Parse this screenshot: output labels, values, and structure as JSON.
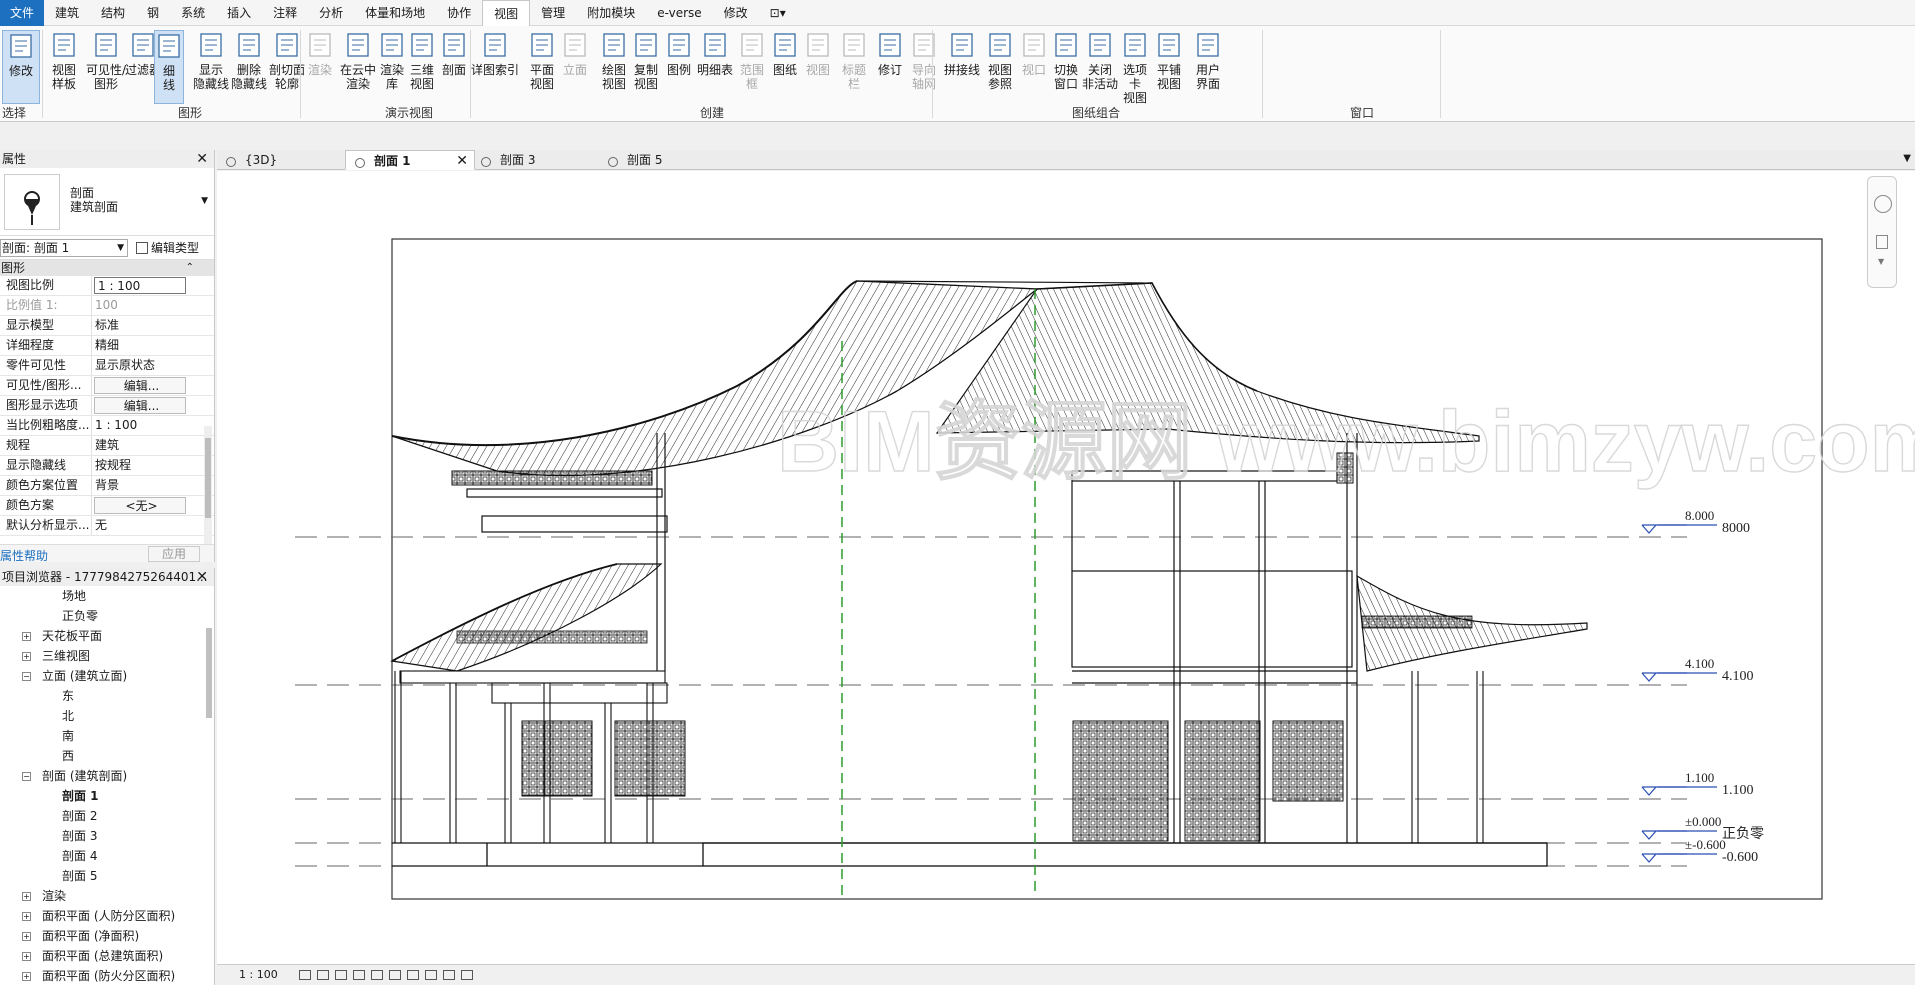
{
  "menu": [
    "文件",
    "建筑",
    "结构",
    "钢",
    "系统",
    "插入",
    "注释",
    "分析",
    "体量和场地",
    "协作",
    "视图",
    "管理",
    "附加模块",
    "e-verse",
    "修改"
  ],
  "menu_active": "视图",
  "ribbon": {
    "buttons": [
      {
        "label": "修改",
        "icon": "cursor-icon",
        "highlight": true
      },
      {
        "label": "视图\n样板",
        "icon": "view-template-icon"
      },
      {
        "label": "可见性/\n图形",
        "icon": "visibility-graphics-icon"
      },
      {
        "label": "过滤器",
        "icon": "filters-icon"
      },
      {
        "label": "细\n线",
        "icon": "thin-lines-icon",
        "highlight": true
      },
      {
        "label": "显示\n隐藏线",
        "icon": "show-hidden-lines-icon"
      },
      {
        "label": "删除\n隐藏线",
        "icon": "remove-hidden-lines-icon"
      },
      {
        "label": "剖切面\n轮廓",
        "icon": "cut-profile-icon"
      },
      {
        "label": "渲染",
        "icon": "render-icon",
        "disabled": true
      },
      {
        "label": "在云中\n渲染",
        "icon": "cloud-render-icon"
      },
      {
        "label": "渲染\n库",
        "icon": "render-gallery-icon"
      },
      {
        "label": "三维\n视图",
        "icon": "3d-view-icon"
      },
      {
        "label": "剖面",
        "icon": "section-icon"
      },
      {
        "label": "详图索引",
        "icon": "callout-icon"
      },
      {
        "label": "平面\n视图",
        "icon": "plan-views-icon"
      },
      {
        "label": "立面",
        "icon": "elevation-icon",
        "disabled": true
      },
      {
        "label": "绘图\n视图",
        "icon": "drafting-view-icon"
      },
      {
        "label": "复制\n视图",
        "icon": "duplicate-view-icon"
      },
      {
        "label": "图例",
        "icon": "legends-icon"
      },
      {
        "label": "明细表",
        "icon": "schedules-icon"
      },
      {
        "label": "范围\n框",
        "icon": "scope-box-icon",
        "disabled": true
      },
      {
        "label": "图纸",
        "icon": "sheet-icon"
      },
      {
        "label": "视图",
        "icon": "view-icon",
        "disabled": true
      },
      {
        "label": "标题\n栏",
        "icon": "title-block-icon",
        "disabled": true
      },
      {
        "label": "修订",
        "icon": "revisions-icon"
      },
      {
        "label": "导向\n轴网",
        "icon": "guide-grid-icon",
        "disabled": true
      },
      {
        "label": "拼接线",
        "icon": "matchline-icon"
      },
      {
        "label": "视图\n参照",
        "icon": "view-reference-icon"
      },
      {
        "label": "视口",
        "icon": "viewports-icon",
        "disabled": true
      },
      {
        "label": "切换\n窗口",
        "icon": "switch-windows-icon"
      },
      {
        "label": "关闭\n非活动",
        "icon": "close-inactive-icon"
      },
      {
        "label": "选项卡\n视图",
        "icon": "tab-views-icon"
      },
      {
        "label": "平铺\n视图",
        "icon": "tile-views-icon"
      },
      {
        "label": "用户\n界面",
        "icon": "user-interface-icon"
      }
    ],
    "panels": [
      "选择",
      "图形",
      "演示视图",
      "创建",
      "图纸组合",
      "窗口"
    ]
  },
  "properties": {
    "title": "属性",
    "type_name": "剖面",
    "type_sub": "建筑剖面",
    "instance": "剖面: 剖面 1",
    "edit_type": "编辑类型",
    "group": "图形",
    "rows": [
      {
        "k": "视图比例",
        "v": "1 : 100",
        "style": "box"
      },
      {
        "k": "比例值 1:",
        "v": "100",
        "style": "dim"
      },
      {
        "k": "显示模型",
        "v": "标准"
      },
      {
        "k": "详细程度",
        "v": "精细"
      },
      {
        "k": "零件可见性",
        "v": "显示原状态"
      },
      {
        "k": "可见性/图形...",
        "v": "编辑...",
        "style": "btn"
      },
      {
        "k": "图形显示选项",
        "v": "编辑...",
        "style": "btn"
      },
      {
        "k": "当比例粗略度...",
        "v": "1 : 100"
      },
      {
        "k": "规程",
        "v": "建筑"
      },
      {
        "k": "显示隐藏线",
        "v": "按规程"
      },
      {
        "k": "颜色方案位置",
        "v": "背景"
      },
      {
        "k": "颜色方案",
        "v": "<无>",
        "style": "btn"
      },
      {
        "k": "默认分析显示...",
        "v": "无"
      }
    ],
    "help": "属性帮助",
    "apply": "应用"
  },
  "browser": {
    "title": "项目浏览器 - 1777984275264401...",
    "items": [
      {
        "label": "场地",
        "level": 2
      },
      {
        "label": "正负零",
        "level": 2
      },
      {
        "label": "天花板平面",
        "level": 1,
        "exp": "+"
      },
      {
        "label": "三维视图",
        "level": 1,
        "exp": "+"
      },
      {
        "label": "立面 (建筑立面)",
        "level": 1,
        "exp": "-"
      },
      {
        "label": "东",
        "level": 2
      },
      {
        "label": "北",
        "level": 2
      },
      {
        "label": "南",
        "level": 2
      },
      {
        "label": "西",
        "level": 2
      },
      {
        "label": "剖面 (建筑剖面)",
        "level": 1,
        "exp": "-"
      },
      {
        "label": "剖面 1",
        "level": 2,
        "bold": true
      },
      {
        "label": "剖面 2",
        "level": 2
      },
      {
        "label": "剖面 3",
        "level": 2
      },
      {
        "label": "剖面 4",
        "level": 2
      },
      {
        "label": "剖面 5",
        "level": 2
      },
      {
        "label": "渲染",
        "level": 1,
        "exp": "+"
      },
      {
        "label": "面积平面 (人防分区面积)",
        "level": 1,
        "exp": "+"
      },
      {
        "label": "面积平面 (净面积)",
        "level": 1,
        "exp": "+"
      },
      {
        "label": "面积平面 (总建筑面积)",
        "level": 1,
        "exp": "+"
      },
      {
        "label": "面积平面 (防火分区面积)",
        "level": 1,
        "exp": "+"
      }
    ]
  },
  "tabs": [
    {
      "label": "{3D}",
      "active": false
    },
    {
      "label": "剖面 1",
      "active": true
    },
    {
      "label": "剖面 3",
      "active": false
    },
    {
      "label": "剖面 5",
      "active": false
    }
  ],
  "levels": [
    {
      "elev": "8.000",
      "name": "8000"
    },
    {
      "elev": "4.100",
      "name": "4.100"
    },
    {
      "elev": "1.100",
      "name": "1.100"
    },
    {
      "elev": "±0.000",
      "name": "正负零"
    },
    {
      "elev": "±-0.600",
      "name": "-0.600"
    }
  ],
  "watermark": "BIM资源网 www.bimzyw.com",
  "status": {
    "scale": "1 : 100"
  },
  "colors": {
    "accent": "#1d6fc0",
    "grid_green": "#2a9d2a",
    "level_blue": "#2b4fb5"
  }
}
